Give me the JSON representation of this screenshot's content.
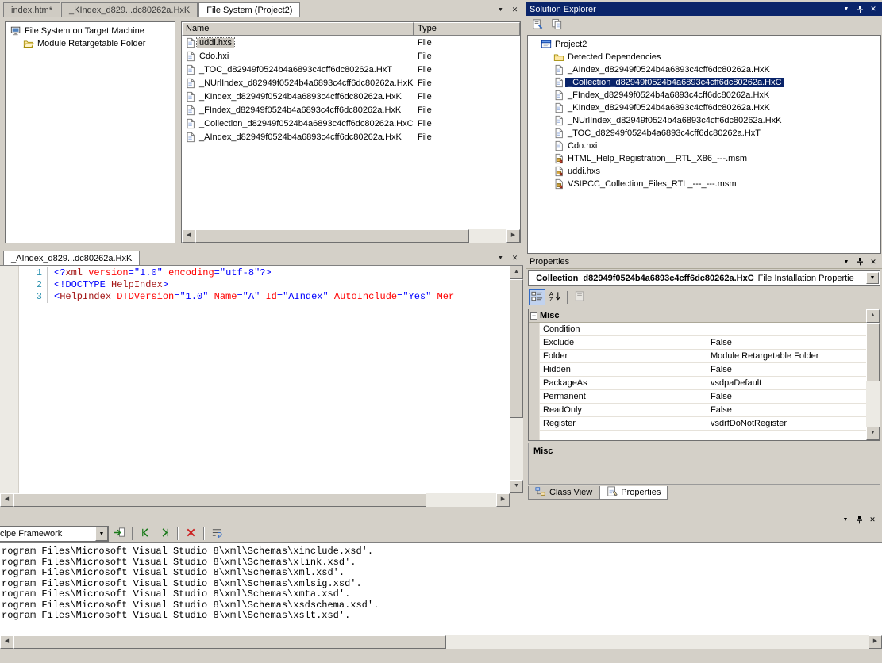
{
  "colors": {
    "chrome": "#D4D0C8",
    "selection_navy": "#0A246A",
    "active_titlebar": "#0A246A",
    "syntax_tag": "#A31515",
    "syntax_attribute": "#FF0000",
    "syntax_value": "#0000FF",
    "syntax_delimiter": "#0000FF",
    "line_number": "#2B91AF"
  },
  "document_tabs": {
    "tabs": [
      {
        "label": "index.htm*",
        "active": false
      },
      {
        "label": "_KIndex_d829...dc80262a.HxK",
        "active": false
      },
      {
        "label": "File System (Project2)",
        "active": true
      }
    ]
  },
  "file_system_designer": {
    "tree_items": [
      {
        "label": "File System on Target Machine",
        "icon": "computer",
        "indent": 0
      },
      {
        "label": "Module Retargetable Folder",
        "icon": "open-folder",
        "indent": 1
      }
    ],
    "list": {
      "columns": [
        {
          "label": "Name"
        },
        {
          "label": "Type"
        }
      ],
      "rows": [
        {
          "name": "uddi.hxs",
          "type": "File",
          "icon": "document",
          "selected": true
        },
        {
          "name": "Cdo.hxi",
          "type": "File",
          "icon": "document",
          "selected": false
        },
        {
          "name": "_TOC_d82949f0524b4a6893c4cff6dc80262a.HxT",
          "type": "File",
          "icon": "document",
          "selected": false
        },
        {
          "name": "_NUrlIndex_d82949f0524b4a6893c4cff6dc80262a.HxK",
          "type": "File",
          "icon": "document",
          "selected": false
        },
        {
          "name": "_KIndex_d82949f0524b4a6893c4cff6dc80262a.HxK",
          "type": "File",
          "icon": "document",
          "selected": false
        },
        {
          "name": "_FIndex_d82949f0524b4a6893c4cff6dc80262a.HxK",
          "type": "File",
          "icon": "document",
          "selected": false
        },
        {
          "name": "_Collection_d82949f0524b4a6893c4cff6dc80262a.HxC",
          "type": "File",
          "icon": "document",
          "selected": false
        },
        {
          "name": "_AIndex_d82949f0524b4a6893c4cff6dc80262a.HxK",
          "type": "File",
          "icon": "document",
          "selected": false
        }
      ]
    }
  },
  "code_editor": {
    "tab_label": "_AIndex_d829...dc80262a.HxK",
    "lines": [
      {
        "num": "1",
        "segments": [
          {
            "t": "<?",
            "c": "d"
          },
          {
            "t": "xml",
            "c": "t"
          },
          {
            "t": " ",
            "c": "p"
          },
          {
            "t": "version",
            "c": "a"
          },
          {
            "t": "=",
            "c": "d"
          },
          {
            "t": "\"1.0\"",
            "c": "v"
          },
          {
            "t": " ",
            "c": "p"
          },
          {
            "t": "encoding",
            "c": "a"
          },
          {
            "t": "=",
            "c": "d"
          },
          {
            "t": "\"utf-8\"",
            "c": "v"
          },
          {
            "t": "?>",
            "c": "d"
          }
        ]
      },
      {
        "num": "2",
        "segments": [
          {
            "t": "<!",
            "c": "d"
          },
          {
            "t": "DOCTYPE",
            "c": "d"
          },
          {
            "t": " ",
            "c": "p"
          },
          {
            "t": "HelpIndex",
            "c": "t"
          },
          {
            "t": ">",
            "c": "d"
          }
        ]
      },
      {
        "num": "3",
        "segments": [
          {
            "t": "<",
            "c": "d"
          },
          {
            "t": "HelpIndex",
            "c": "t"
          },
          {
            "t": " ",
            "c": "p"
          },
          {
            "t": "DTDVersion",
            "c": "a"
          },
          {
            "t": "=",
            "c": "d"
          },
          {
            "t": "\"1.0\"",
            "c": "v"
          },
          {
            "t": " ",
            "c": "p"
          },
          {
            "t": "Name",
            "c": "a"
          },
          {
            "t": "=",
            "c": "d"
          },
          {
            "t": "\"A\"",
            "c": "v"
          },
          {
            "t": " ",
            "c": "p"
          },
          {
            "t": "Id",
            "c": "a"
          },
          {
            "t": "=",
            "c": "d"
          },
          {
            "t": "\"AIndex\"",
            "c": "v"
          },
          {
            "t": " ",
            "c": "p"
          },
          {
            "t": "AutoInclude",
            "c": "a"
          },
          {
            "t": "=",
            "c": "d"
          },
          {
            "t": "\"Yes\"",
            "c": "v"
          },
          {
            "t": " ",
            "c": "p"
          },
          {
            "t": "Mer",
            "c": "a"
          }
        ]
      }
    ]
  },
  "solution_explorer": {
    "title": "Solution Explorer",
    "toolbar": [
      {
        "icon": "properties"
      },
      {
        "icon": "show-all-files"
      }
    ],
    "items": [
      {
        "label": "Project2",
        "icon": "project",
        "indent": 0,
        "selected": false
      },
      {
        "label": "Detected Dependencies",
        "icon": "folder",
        "indent": 1,
        "selected": false
      },
      {
        "label": "_AIndex_d82949f0524b4a6893c4cff6dc80262a.HxK",
        "icon": "document",
        "indent": 1,
        "selected": false
      },
      {
        "label": "_Collection_d82949f0524b4a6893c4cff6dc80262a.HxC",
        "icon": "document",
        "indent": 1,
        "selected": true
      },
      {
        "label": "_FIndex_d82949f0524b4a6893c4cff6dc80262a.HxK",
        "icon": "document",
        "indent": 1,
        "selected": false
      },
      {
        "label": "_KIndex_d82949f0524b4a6893c4cff6dc80262a.HxK",
        "icon": "document",
        "indent": 1,
        "selected": false
      },
      {
        "label": "_NUrlIndex_d82949f0524b4a6893c4cff6dc80262a.HxK",
        "icon": "document",
        "indent": 1,
        "selected": false
      },
      {
        "label": "_TOC_d82949f0524b4a6893c4cff6dc80262a.HxT",
        "icon": "document",
        "indent": 1,
        "selected": false
      },
      {
        "label": "Cdo.hxi",
        "icon": "document",
        "indent": 1,
        "selected": false
      },
      {
        "label": "HTML_Help_Registration__RTL_X86_---.msm",
        "icon": "merge-module",
        "indent": 1,
        "selected": false
      },
      {
        "label": "uddi.hxs",
        "icon": "merge-module",
        "indent": 1,
        "selected": false
      },
      {
        "label": "VSIPCC_Collection_Files_RTL_---_---.msm",
        "icon": "merge-module",
        "indent": 1,
        "selected": false
      }
    ]
  },
  "properties_panel": {
    "title": "Properties",
    "object_name": "_Collection_d82949f0524b4a6893c4cff6dc80262a.HxC",
    "object_type": "File Installation Propertie",
    "toolbar": [
      {
        "icon": "categorized",
        "selected": true
      },
      {
        "icon": "alphabetical"
      },
      {
        "separator": true
      },
      {
        "icon": "property-pages",
        "disabled": true
      }
    ],
    "category": "Misc",
    "rows": [
      {
        "name": "Condition",
        "value": ""
      },
      {
        "name": "Exclude",
        "value": "False"
      },
      {
        "name": "Folder",
        "value": "Module Retargetable Folder"
      },
      {
        "name": "Hidden",
        "value": "False"
      },
      {
        "name": "PackageAs",
        "value": "vsdpaDefault"
      },
      {
        "name": "Permanent",
        "value": "False"
      },
      {
        "name": "ReadOnly",
        "value": "False"
      },
      {
        "name": "Register",
        "value": "vsdrfDoNotRegister"
      }
    ],
    "description_title": "Misc",
    "bottom_tabs": [
      {
        "label": "Class View",
        "icon": "class-view",
        "active": false
      },
      {
        "label": "Properties",
        "icon": "properties-tab",
        "active": true
      }
    ]
  },
  "output_panel": {
    "combo_value": "cipe Framework",
    "toolbar": [
      {
        "icon": "go-to-source"
      },
      {
        "separator": true
      },
      {
        "icon": "previous-message"
      },
      {
        "icon": "next-message"
      },
      {
        "separator": true
      },
      {
        "icon": "clear-all"
      },
      {
        "separator": true
      },
      {
        "icon": "toggle-word-wrap"
      }
    ],
    "lines": [
      "rogram Files\\Microsoft Visual Studio 8\\xml\\Schemas\\xinclude.xsd'.",
      "rogram Files\\Microsoft Visual Studio 8\\xml\\Schemas\\xlink.xsd'.",
      "rogram Files\\Microsoft Visual Studio 8\\xml\\Schemas\\xml.xsd'.",
      "rogram Files\\Microsoft Visual Studio 8\\xml\\Schemas\\xmlsig.xsd'.",
      "rogram Files\\Microsoft Visual Studio 8\\xml\\Schemas\\xmta.xsd'.",
      "rogram Files\\Microsoft Visual Studio 8\\xml\\Schemas\\xsdschema.xsd'.",
      "rogram Files\\Microsoft Visual Studio 8\\xml\\Schemas\\xslt.xsd'."
    ]
  }
}
